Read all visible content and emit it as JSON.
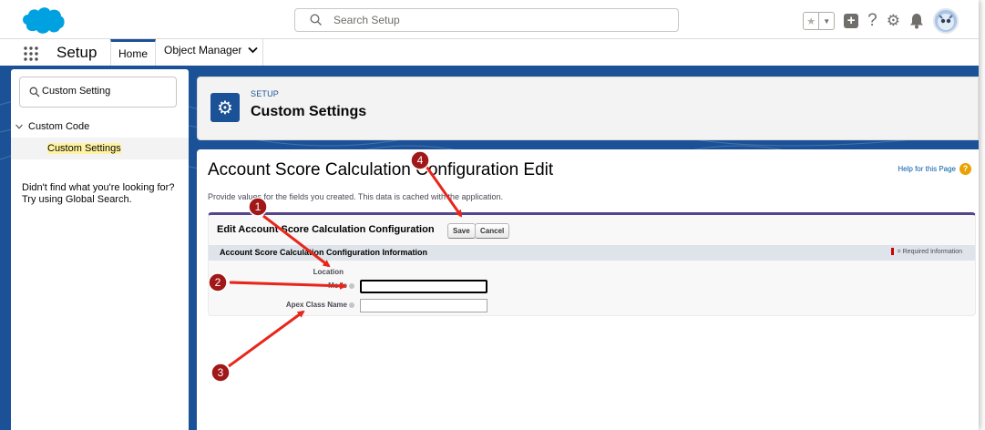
{
  "header": {
    "search_placeholder": "Search Setup",
    "brand_color": "#00a1e0"
  },
  "nav": {
    "app_name": "Setup",
    "tabs": [
      {
        "label": "Home",
        "active": true
      },
      {
        "label": "Object Manager",
        "has_dropdown": true
      }
    ]
  },
  "sidebar": {
    "quick_find_value": "Custom Setting",
    "tree": {
      "node_label": "Custom Code",
      "leaf_label": "Custom Settings"
    },
    "not_found_text": "Didn't find what you're looking for? Try using Global Search."
  },
  "page_header": {
    "eyebrow": "SETUP",
    "title": "Custom Settings"
  },
  "main": {
    "title": "Account Score Calculation Configuration Edit",
    "help_link": "Help for this Page",
    "description": "Provide values for the fields you created. This data is cached with the application.",
    "block_title": "Edit Account Score Calculation Configuration",
    "save_label": "Save",
    "cancel_label": "Cancel",
    "section_title": "Account Score Calculation Configuration Information",
    "required_legend": "= Required Information",
    "fields": [
      {
        "label": "Location",
        "value": ""
      },
      {
        "label": "Mode",
        "value": ""
      },
      {
        "label": "Apex Class Name",
        "value": ""
      }
    ]
  },
  "annotations": {
    "color": "#a01818",
    "arrow_color": "#e8261c",
    "markers": [
      "1",
      "2",
      "3",
      "4"
    ]
  }
}
